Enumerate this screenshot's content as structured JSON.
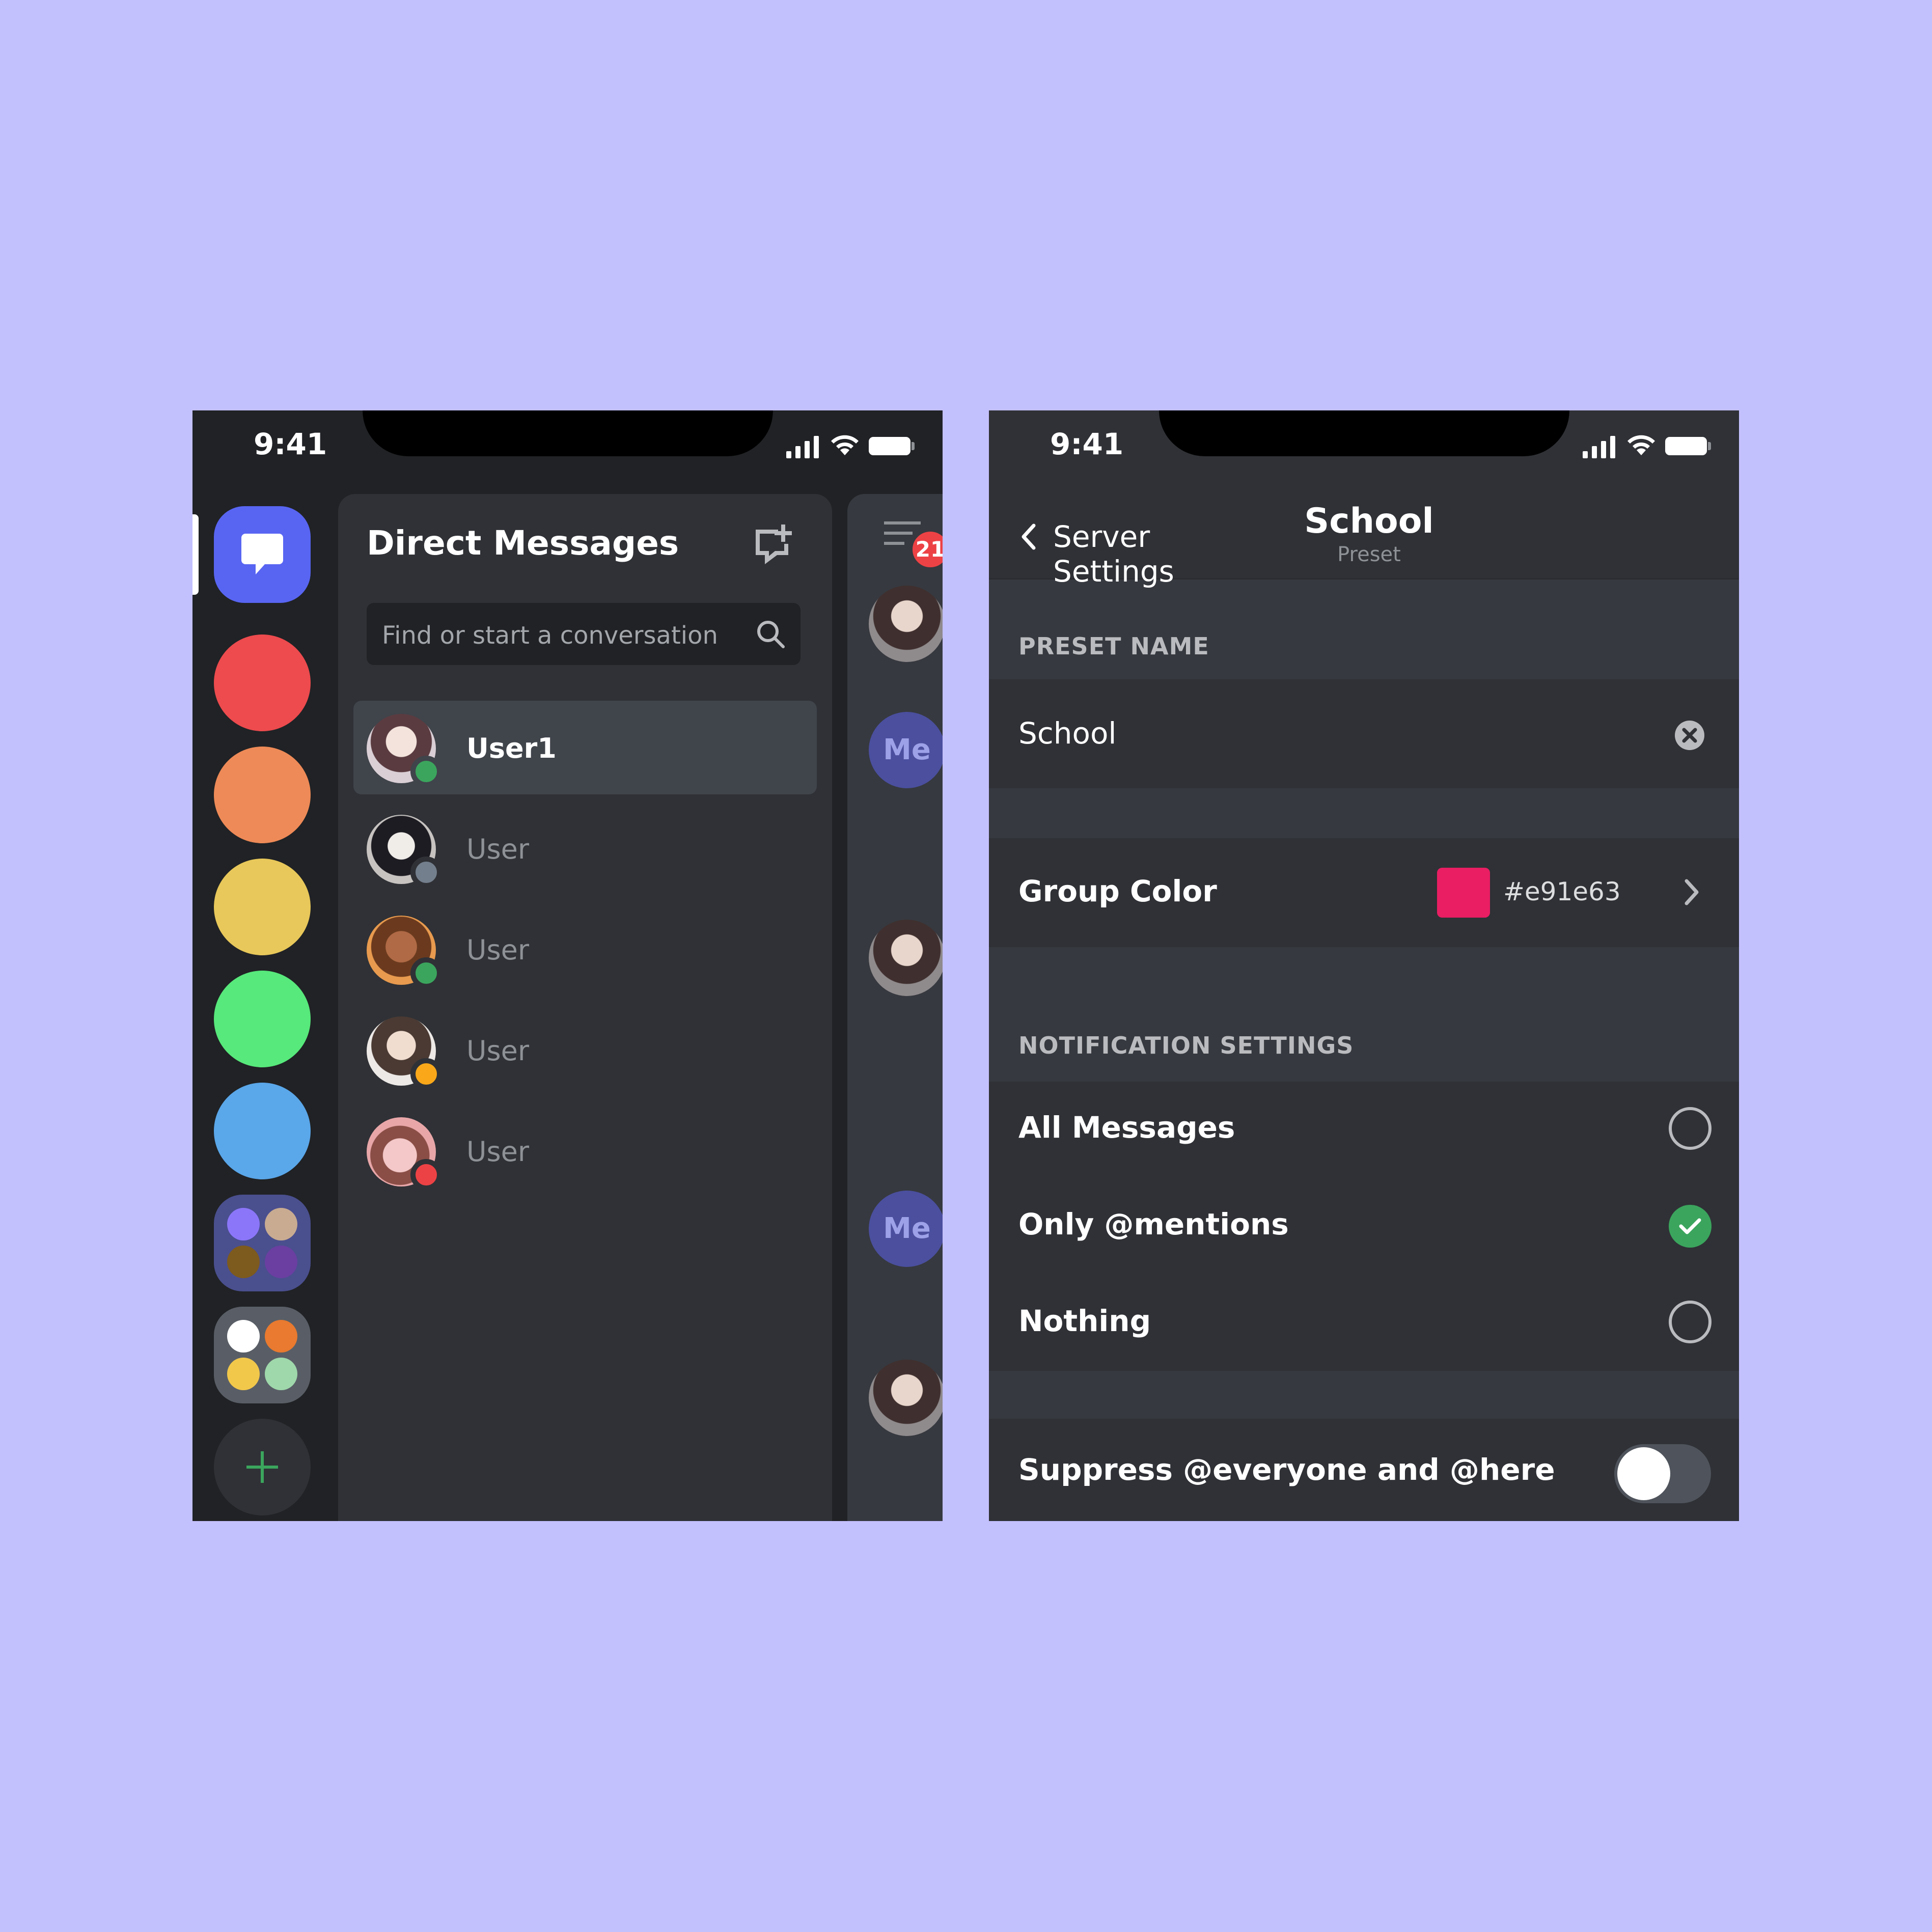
{
  "colors": {
    "background": "#c3c0fe",
    "blurple": "#5865f2",
    "server_colors": [
      "#ed4b4e",
      "#ee8a57",
      "#e8c85a",
      "#57e97b",
      "#5aa7ea"
    ],
    "folder1_dots": [
      "#8b76f9",
      "#c8ab91",
      "#7d5a1e",
      "#6a3fa1"
    ],
    "folder2_dots": [
      "#ffffff",
      "#e97a2f",
      "#f2c84b",
      "#9fd8ab"
    ],
    "online": "#3ba55d",
    "idle": "#faa81a",
    "dnd": "#ed4245",
    "offline": "#747f8d",
    "group_color": "#e91e63"
  },
  "left_phone": {
    "status_time": "9:41",
    "dm_panel": {
      "title": "Direct Messages",
      "search_placeholder": "Find or start a conversation",
      "users": [
        {
          "name": "User1",
          "status": "online",
          "active": true
        },
        {
          "name": "User",
          "status": "offline",
          "active": false
        },
        {
          "name": "User",
          "status": "online",
          "active": false
        },
        {
          "name": "User",
          "status": "idle",
          "active": false
        },
        {
          "name": "User",
          "status": "dnd",
          "active": false
        }
      ]
    },
    "chat_peek": {
      "notification_badge": "21",
      "me_label": "Me"
    }
  },
  "right_phone": {
    "status_time": "9:41",
    "header": {
      "back_label": "Server Settings",
      "title": "School",
      "subtitle": "Preset"
    },
    "preset_name_label": "PRESET NAME",
    "preset_name_value": "School",
    "group_color": {
      "label": "Group Color",
      "hex": "#e91e63"
    },
    "notification_label": "NOTIFICATION SETTINGS",
    "notification_options": [
      {
        "label": "All Messages",
        "checked": false
      },
      {
        "label": "Only @mentions",
        "checked": true
      },
      {
        "label": "Nothing",
        "checked": false
      }
    ],
    "suppress": {
      "label": "Suppress @everyone and @here",
      "enabled": false
    }
  }
}
